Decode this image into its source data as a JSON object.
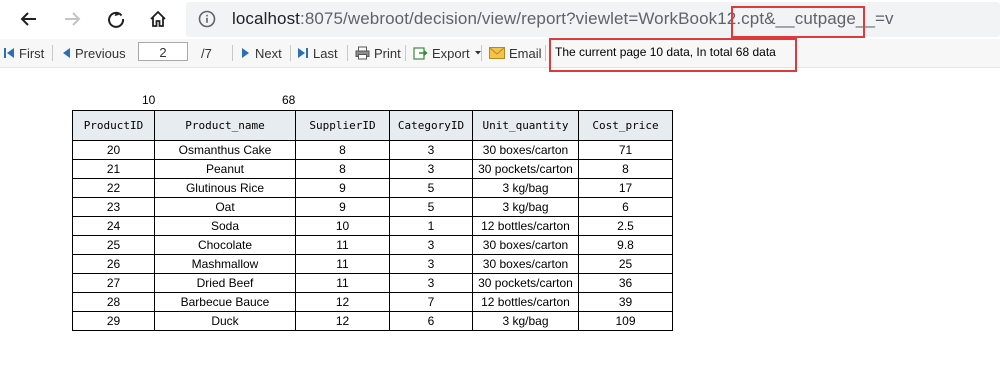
{
  "browser": {
    "url_host": "localhost",
    "url_rest": ":8075/webroot/decision/view/report?viewlet=WorkBook12.cpt",
    "url_param": "&__cutpage__=v"
  },
  "toolbar": {
    "first_label": "First",
    "previous_label": "Previous",
    "page_input_value": "2",
    "total_pages_label": "/7",
    "next_label": "Next",
    "last_label": "Last",
    "print_label": "Print",
    "export_label": "Export",
    "email_label": "Email",
    "status_message": "The current page 10 data,  In total 68 data"
  },
  "report": {
    "page_count_value": "10",
    "total_count_value": "68",
    "columns": [
      "ProductID",
      "Product_name",
      "SupplierID",
      "CategoryID",
      "Unit_quantity",
      "Cost_price"
    ],
    "rows": [
      [
        "20",
        "Osmanthus Cake",
        "8",
        "3",
        "30 boxes/carton",
        "71"
      ],
      [
        "21",
        "Peanut",
        "8",
        "3",
        "30 pockets/carton",
        "8"
      ],
      [
        "22",
        "Glutinous Rice",
        "9",
        "5",
        "3 kg/bag",
        "17"
      ],
      [
        "23",
        "Oat",
        "9",
        "5",
        "3 kg/bag",
        "6"
      ],
      [
        "24",
        "Soda",
        "10",
        "1",
        "12 bottles/carton",
        "2.5"
      ],
      [
        "25",
        "Chocolate",
        "11",
        "3",
        "30 boxes/carton",
        "9.8"
      ],
      [
        "26",
        "Mashmallow",
        "11",
        "3",
        "30 boxes/carton",
        "25"
      ],
      [
        "27",
        "Dried Beef",
        "11",
        "3",
        "30 pockets/carton",
        "36"
      ],
      [
        "28",
        "Barbecue Bauce",
        "12",
        "7",
        "12 bottles/carton",
        "39"
      ],
      [
        "29",
        "Duck",
        "12",
        "6",
        "3 kg/bag",
        "109"
      ]
    ]
  },
  "colors": {
    "highlight": "#e0393b",
    "header_bg": "#e7ecf1",
    "icon_blue": "#2a6fb8"
  }
}
